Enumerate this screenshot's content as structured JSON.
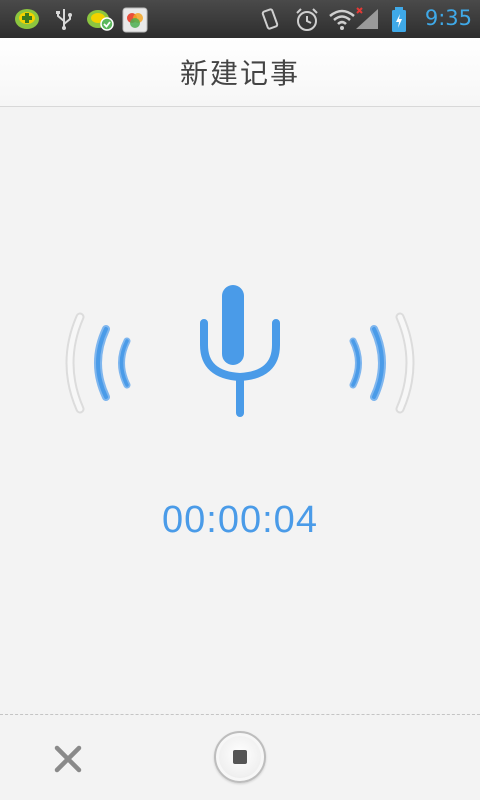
{
  "status_bar": {
    "time": "9:35",
    "icons": [
      "app-notification-icon",
      "usb-icon",
      "app-update-icon",
      "photo-app-icon",
      "vibrate-icon",
      "alarm-icon",
      "wifi-icon",
      "signal-icon",
      "battery-charging-icon"
    ]
  },
  "header": {
    "title": "新建记事"
  },
  "recorder": {
    "elapsed": "00:00:04",
    "icon": "microphone-icon"
  },
  "controls": {
    "cancel_icon": "close-icon",
    "stop_icon": "stop-icon"
  },
  "colors": {
    "accent": "#4a9be8",
    "status_time": "#3fa9e8",
    "status_bg": "#383838",
    "background": "#f3f3f3"
  }
}
